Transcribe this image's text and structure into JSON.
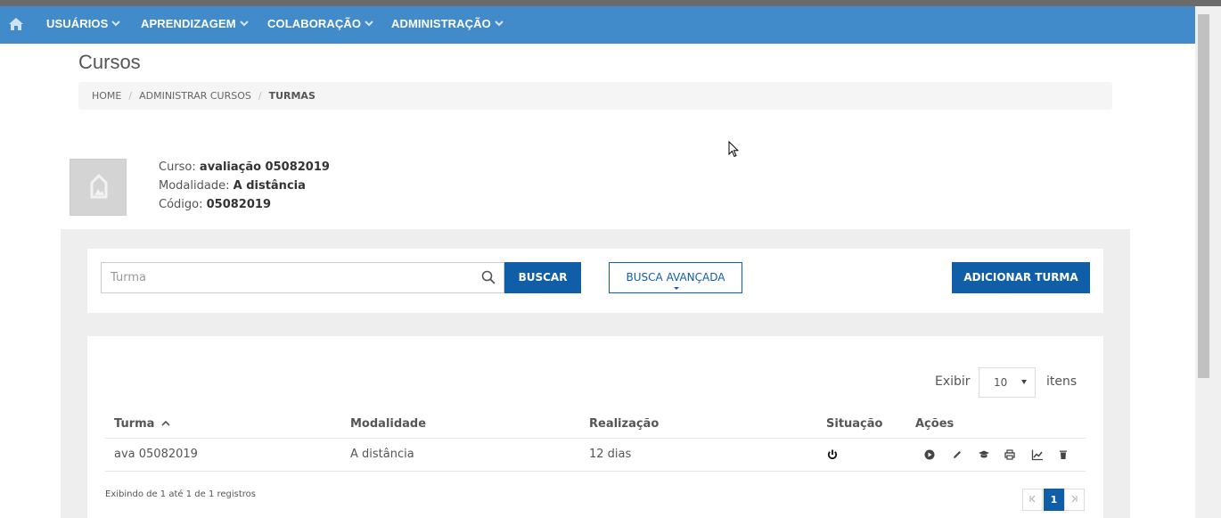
{
  "nav": {
    "items": [
      {
        "label": "USUÁRIOS"
      },
      {
        "label": "APRENDIZAGEM"
      },
      {
        "label": "COLABORAÇÃO"
      },
      {
        "label": "ADMINISTRAÇÃO"
      }
    ],
    "bg_color": "#428bca"
  },
  "page": {
    "title": "Cursos",
    "breadcrumb": [
      "HOME",
      "ADMINISTRAR CURSOS",
      "TURMAS"
    ]
  },
  "course": {
    "curso_label": "Curso:",
    "curso_value": "avaliação 05082019",
    "modalidade_label": "Modalidade:",
    "modalidade_value": "A distância",
    "codigo_label": "Código:",
    "codigo_value": "05082019"
  },
  "search": {
    "placeholder": "Turma",
    "buscar_label": "BUSCAR",
    "avancada_label": "BUSCA AVANÇADA",
    "adicionar_label": "ADICIONAR TURMA"
  },
  "table": {
    "exibir_label": "Exibir",
    "page_size": "10",
    "itens_label": "itens",
    "columns": [
      "Turma",
      "Modalidade",
      "Realização",
      "Situação",
      "Ações"
    ],
    "rows": [
      {
        "turma": "ava 05082019",
        "modalidade": "A distância",
        "realizacao": "12 dias"
      }
    ],
    "footer": "Exibindo de 1 até 1 de 1 registros",
    "current_page": "1"
  },
  "colors": {
    "primary": "#105ea8",
    "nav": "#428bca"
  }
}
